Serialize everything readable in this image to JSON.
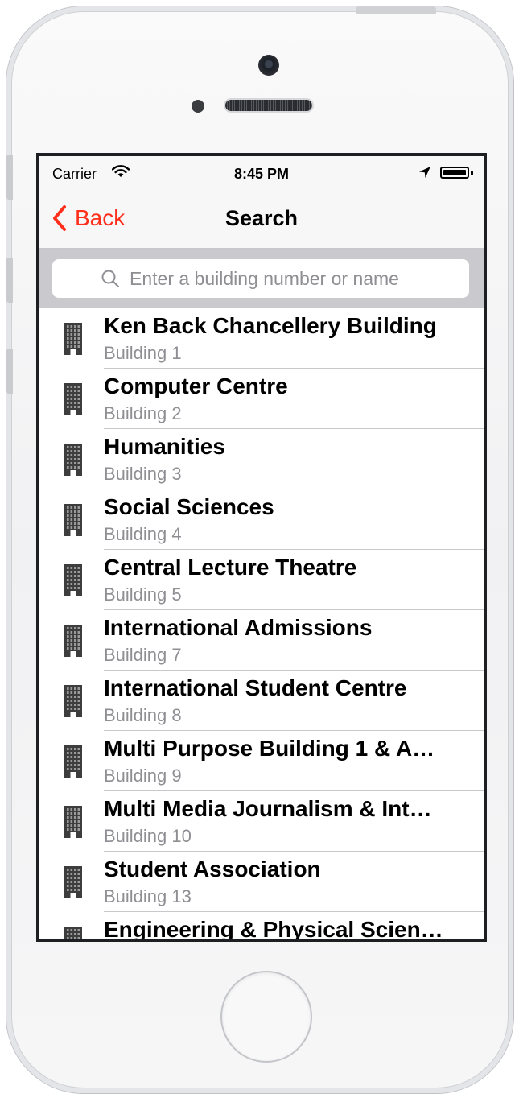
{
  "status": {
    "carrier": "Carrier",
    "time": "8:45 PM"
  },
  "nav": {
    "back_label": "Back",
    "title": "Search"
  },
  "search": {
    "placeholder": "Enter a building number or name"
  },
  "colors": {
    "accent": "#ff2d1a",
    "secondary_text": "#8e8e93",
    "separator": "#c8c7cc",
    "search_bar_bg": "#c9c9ce"
  },
  "buildings": [
    {
      "name": "Ken Back Chancellery Building",
      "number": "Building 1"
    },
    {
      "name": "Computer Centre",
      "number": "Building 2"
    },
    {
      "name": "Humanities",
      "number": "Building 3"
    },
    {
      "name": "Social Sciences",
      "number": "Building 4"
    },
    {
      "name": "Central Lecture Theatre",
      "number": "Building 5"
    },
    {
      "name": "International Admissions",
      "number": "Building 7"
    },
    {
      "name": "International Student Centre",
      "number": "Building 8"
    },
    {
      "name": "Multi Purpose Building 1 & A…",
      "number": "Building 9"
    },
    {
      "name": "Multi Media Journalism & Int…",
      "number": "Building 10"
    },
    {
      "name": "Student Association",
      "number": "Building 13"
    },
    {
      "name": "Engineering & Physical Scien…",
      "number": ""
    }
  ],
  "icons": {
    "row_icon": "building-icon"
  }
}
